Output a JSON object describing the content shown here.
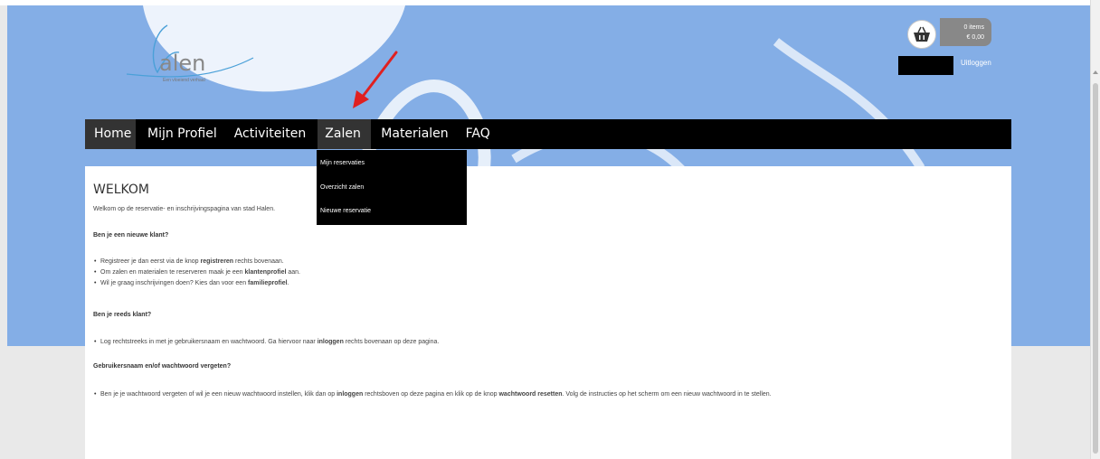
{
  "header": {
    "logo_word": "alen",
    "logo_tagline": "Een vloeiend verhaal",
    "cart": {
      "items_label": "0 items",
      "total_label": "€ 0,00"
    },
    "logout_label": "Uitloggen"
  },
  "nav": {
    "items": [
      {
        "label": "Home"
      },
      {
        "label": "Mijn Profiel"
      },
      {
        "label": "Activiteiten"
      },
      {
        "label": "Zalen"
      },
      {
        "label": "Materialen"
      },
      {
        "label": "FAQ"
      }
    ],
    "dropdown": [
      {
        "label": "Mijn reservaties"
      },
      {
        "label": "Overzicht zalen"
      },
      {
        "label": "Nieuwe reservatie"
      }
    ]
  },
  "content": {
    "title": "WELKOM",
    "intro": "Welkom op de reservatie- en inschrijvingspagina van stad Halen.",
    "new_customer": {
      "heading": "Ben je een nieuwe klant?",
      "bullets": [
        {
          "a": "Registreer je dan eerst via de knop ",
          "b": "registreren",
          "c": " rechts bovenaan."
        },
        {
          "a": "Om zalen en materialen te reserveren maak je een ",
          "b": "klantenprofiel",
          "c": " aan."
        },
        {
          "a": "Wil je graag inschrijvingen doen? Kies dan voor een ",
          "b": "familieprofiel",
          "c": "."
        }
      ]
    },
    "existing_customer": {
      "heading": "Ben je reeds klant?",
      "bullet": {
        "a": "Log rechtstreeks in met je gebruikersnaam en wachtwoord. Ga hiervoor naar ",
        "b": "inloggen",
        "c": " rechts bovenaan op deze pagina."
      }
    },
    "forgot": {
      "heading": "Gebruikersnaam en/of wachtwoord vergeten?",
      "bullet": {
        "a": "Ben je je wachtwoord vergeten of wil je een nieuw wachtwoord instellen, klik dan op ",
        "b": "inloggen",
        "c": " rechtsboven op deze pagina en klik op de knop ",
        "d": "wachtwoord resetten",
        "e": ". Volg de instructies op het scherm om een nieuw wachtwoord in te stellen."
      }
    }
  },
  "colors": {
    "header_bg": "#84aee6",
    "nav_bg": "#000000",
    "nav_active": "#333333",
    "annotation_arrow": "#e02020"
  }
}
